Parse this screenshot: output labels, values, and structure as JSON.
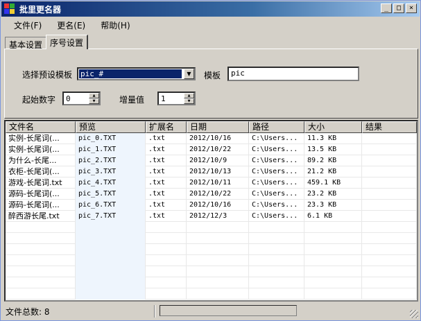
{
  "window": {
    "title": "批里更名器",
    "buttons": {
      "minimize": "_",
      "maximize": "□",
      "close": "×"
    }
  },
  "menu": {
    "items": [
      "文件(F)",
      "更名(E)",
      "帮助(H)"
    ]
  },
  "tabs": [
    {
      "label": "基本设置",
      "active": false
    },
    {
      "label": "序号设置",
      "active": true
    }
  ],
  "settings": {
    "preset_label": "选择预设模板",
    "preset_value": "pic_#",
    "template_label": "模板",
    "template_value": "pic",
    "start_label": "起始数字",
    "start_value": "0",
    "increment_label": "增量值",
    "increment_value": "1"
  },
  "table": {
    "columns": [
      "文件名",
      "预览",
      "扩展名",
      "日期",
      "路径",
      "大小",
      "结果"
    ],
    "rows": [
      [
        "实例-长尾词(...",
        "pic_0.TXT",
        ".txt",
        "2012/10/16",
        "C:\\Users...",
        "11.3 KB",
        ""
      ],
      [
        "实例-长尾词(...",
        "pic_1.TXT",
        ".txt",
        "2012/10/22",
        "C:\\Users...",
        "13.5 KB",
        ""
      ],
      [
        "为什么-长尾...",
        "pic_2.TXT",
        ".txt",
        "2012/10/9",
        "C:\\Users...",
        "89.2 KB",
        ""
      ],
      [
        "衣柜-长尾词(...",
        "pic_3.TXT",
        ".txt",
        "2012/10/13",
        "C:\\Users...",
        "21.2 KB",
        ""
      ],
      [
        "游戏-长尾词.txt",
        "pic_4.TXT",
        ".txt",
        "2012/10/11",
        "C:\\Users...",
        "459.1 KB",
        ""
      ],
      [
        "源码-长尾词(...",
        "pic_5.TXT",
        ".txt",
        "2012/10/22",
        "C:\\Users...",
        "23.2 KB",
        ""
      ],
      [
        "源码-长尾词(...",
        "pic_6.TXT",
        ".txt",
        "2012/10/16",
        "C:\\Users...",
        "23.3 KB",
        ""
      ],
      [
        "醉西游长尾.txt",
        "pic_7.TXT",
        ".txt",
        "2012/12/3",
        "C:\\Users...",
        "6.1 KB",
        ""
      ]
    ]
  },
  "status": {
    "file_count": "文件总数: 8",
    "progress": 0
  }
}
